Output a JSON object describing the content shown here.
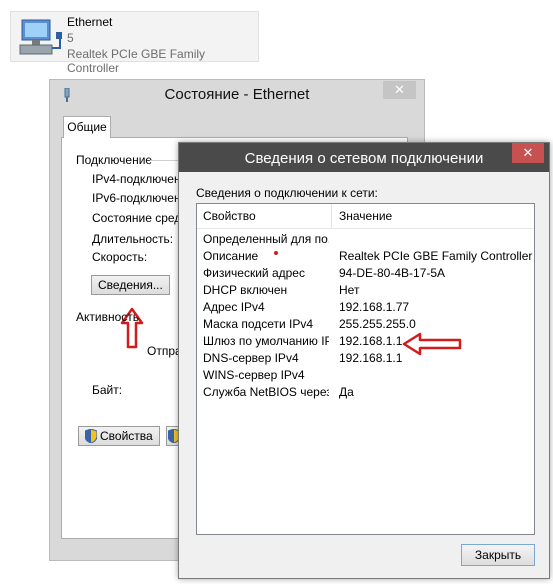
{
  "adapter": {
    "name": "Ethernet",
    "network": "5",
    "device": "Realtek PCIe GBE Family Controller"
  },
  "status_window": {
    "title": "Состояние - Ethernet",
    "tab_general": "Общие",
    "connection_label": "Подключение",
    "fields": [
      "IPv4-подключен",
      "IPv6-подключен",
      "Состояние среды",
      "Длительность:",
      "Скорость:"
    ],
    "details_button": "Сведения...",
    "activity_label": "Активность",
    "sent_label": "Отпра",
    "bytes_label": "Байт:",
    "properties_button": "Свойства"
  },
  "details_dialog": {
    "title": "Сведения о сетевом подключении",
    "caption": "Сведения о подключении к сети:",
    "col_property": "Свойство",
    "col_value": "Значение",
    "rows": [
      {
        "k": "Определенный для по...",
        "v": ""
      },
      {
        "k": "Описание",
        "v": "Realtek PCIe GBE Family Controller"
      },
      {
        "k": "Физический адрес",
        "v": "94-DE-80-4B-17-5A"
      },
      {
        "k": "DHCP включен",
        "v": "Нет"
      },
      {
        "k": "Адрес IPv4",
        "v": "192.168.1.77"
      },
      {
        "k": "Маска подсети IPv4",
        "v": "255.255.255.0"
      },
      {
        "k": "Шлюз по умолчанию IP...",
        "v": "192.168.1.1"
      },
      {
        "k": "DNS-сервер IPv4",
        "v": "192.168.1.1"
      },
      {
        "k": "WINS-сервер IPv4",
        "v": ""
      },
      {
        "k": "Служба NetBIOS через...",
        "v": "Да"
      }
    ],
    "close_button": "Закрыть"
  },
  "colors": {
    "titlebar": "#4a4a4a",
    "close_red": "#c75050",
    "annotation_red": "#d21b1b"
  }
}
